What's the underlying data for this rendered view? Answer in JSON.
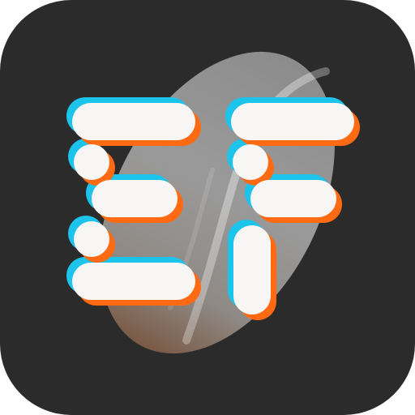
{
  "icon": {
    "name": "ef-app-icon",
    "logo_text": "EF",
    "colors": {
      "tile_background": "#2b2b2b",
      "bar_fill": "#f8f6f4",
      "shadow_cyan": "#1cc3ea",
      "shadow_orange": "#ff6a12",
      "pebble_gray": "#9a9a9a",
      "pebble_brown": "#7a5a45"
    }
  }
}
